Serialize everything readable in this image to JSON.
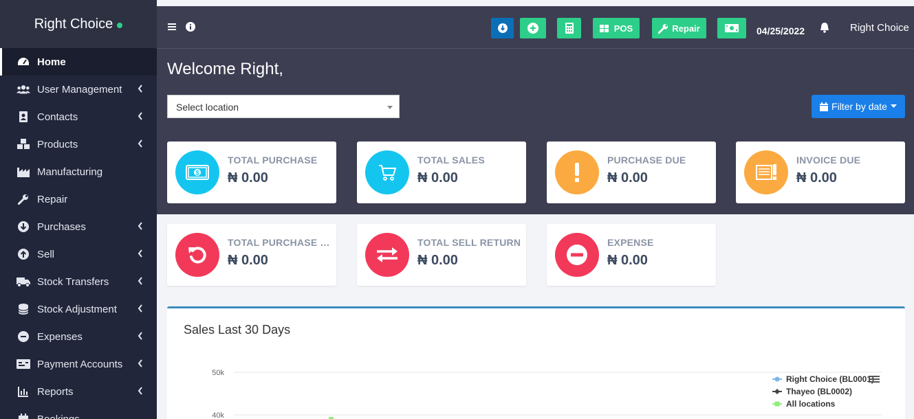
{
  "brand": {
    "name": "Right Choice"
  },
  "sidebar": {
    "items": [
      {
        "label": "Home"
      },
      {
        "label": "User Management"
      },
      {
        "label": "Contacts"
      },
      {
        "label": "Products"
      },
      {
        "label": "Manufacturing"
      },
      {
        "label": "Repair"
      },
      {
        "label": "Purchases"
      },
      {
        "label": "Sell"
      },
      {
        "label": "Stock Transfers"
      },
      {
        "label": "Stock Adjustment"
      },
      {
        "label": "Expenses"
      },
      {
        "label": "Payment Accounts"
      },
      {
        "label": "Reports"
      },
      {
        "label": "Bookings"
      }
    ]
  },
  "header": {
    "pos_label": "POS",
    "repair_label": "Repair",
    "date": "04/25/2022",
    "user": "Right Choice"
  },
  "main": {
    "welcome": "Welcome Right,",
    "location_placeholder": "Select location",
    "filter_label": "Filter by date"
  },
  "cards": [
    {
      "label": "TOTAL PURCHASE",
      "value": "₦ 0.00"
    },
    {
      "label": "TOTAL SALES",
      "value": "₦ 0.00"
    },
    {
      "label": "PURCHASE DUE",
      "value": "₦ 0.00"
    },
    {
      "label": "INVOICE DUE",
      "value": "₦ 0.00"
    },
    {
      "label": "TOTAL PURCHASE RETURN",
      "value": "₦ 0.00"
    },
    {
      "label": "TOTAL SELL RETURN",
      "value": "₦ 0.00"
    },
    {
      "label": "EXPENSE",
      "value": "₦ 0.00"
    }
  ],
  "colors": {
    "accent_green": "#2dce89",
    "accent_blue": "#1a7fe8",
    "sidebar_bg": "#22263a",
    "header_bg": "#3d3e52"
  },
  "chart_data": {
    "type": "line",
    "title": "Sales Last 30 Days",
    "y_ticks": [
      "50k",
      "40k"
    ],
    "series": [
      {
        "name": "Right Choice (BL0001)",
        "color": "#7cb5ec"
      },
      {
        "name": "Thayeo (BL0002)",
        "color": "#434348"
      },
      {
        "name": "All locations",
        "color": "#90ed7d"
      }
    ]
  }
}
